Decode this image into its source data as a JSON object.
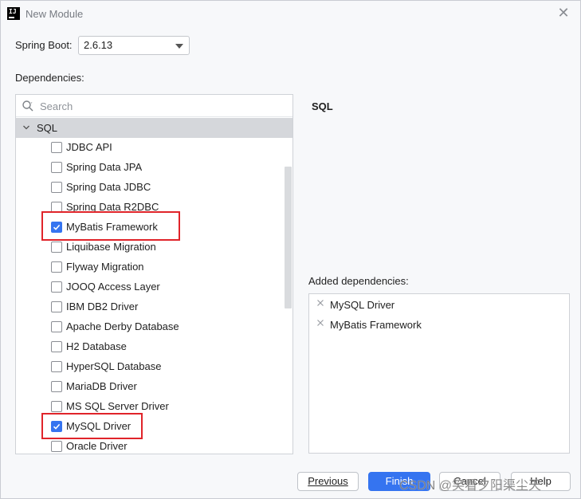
{
  "window": {
    "title": "New Module",
    "app_icon_text": "IJ"
  },
  "spring_boot": {
    "label": "Spring Boot:",
    "value": "2.6.13"
  },
  "dependencies": {
    "label": "Dependencies:",
    "search_placeholder": "Search",
    "group": "SQL",
    "items": [
      {
        "label": "JDBC API",
        "checked": false
      },
      {
        "label": "Spring Data JPA",
        "checked": false
      },
      {
        "label": "Spring Data JDBC",
        "checked": false
      },
      {
        "label": "Spring Data R2DBC",
        "checked": false
      },
      {
        "label": "MyBatis Framework",
        "checked": true
      },
      {
        "label": "Liquibase Migration",
        "checked": false
      },
      {
        "label": "Flyway Migration",
        "checked": false
      },
      {
        "label": "JOOQ Access Layer",
        "checked": false
      },
      {
        "label": "IBM DB2 Driver",
        "checked": false
      },
      {
        "label": "Apache Derby Database",
        "checked": false
      },
      {
        "label": "H2 Database",
        "checked": false
      },
      {
        "label": "HyperSQL Database",
        "checked": false
      },
      {
        "label": "MariaDB Driver",
        "checked": false
      },
      {
        "label": "MS SQL Server Driver",
        "checked": false
      },
      {
        "label": "MySQL Driver",
        "checked": true
      },
      {
        "label": "Oracle Driver",
        "checked": false
      }
    ]
  },
  "detail": {
    "title": "SQL"
  },
  "added": {
    "label": "Added dependencies:",
    "items": [
      "MySQL Driver",
      "MyBatis Framework"
    ]
  },
  "buttons": {
    "previous": "Previous",
    "finish": "Finish",
    "cancel": "Cancel",
    "help": "Help"
  },
  "watermark": "CSDN @笑看夕阳渠尘天",
  "colors": {
    "accent": "#3574f0",
    "highlight": "#e0242a",
    "group_bg": "#d5d7db"
  }
}
